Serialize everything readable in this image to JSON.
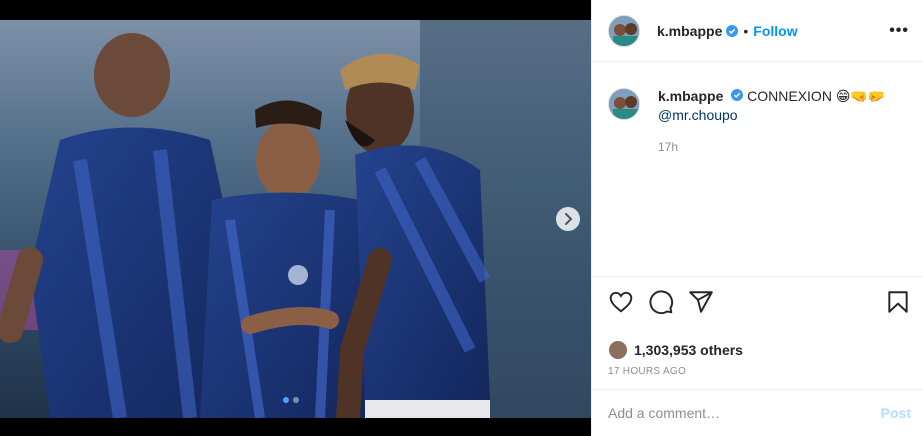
{
  "post": {
    "username": "k.mbappe",
    "follow_label": "Follow",
    "separator": "•",
    "more_label": "•••",
    "caption_text": "CONNEXION 😁🤜🤛",
    "caption_mention": "@mr.choupo",
    "caption_time": "17h",
    "likes_text": "1,303,953 others",
    "posted_ago": "17 HOURS AGO",
    "comment_placeholder": "Add a comment…",
    "post_label": "Post"
  },
  "carousel": {
    "slide_count": 2,
    "active_slide": 1
  },
  "colors": {
    "accent": "#0095f6",
    "verified": "#3897f0",
    "post_disabled": "#b2dffc",
    "muted": "#8e8e8e"
  },
  "icons": [
    "verified-badge-icon",
    "more-options-icon",
    "heart-icon",
    "comment-icon",
    "share-icon",
    "bookmark-icon",
    "next-arrow-icon"
  ]
}
